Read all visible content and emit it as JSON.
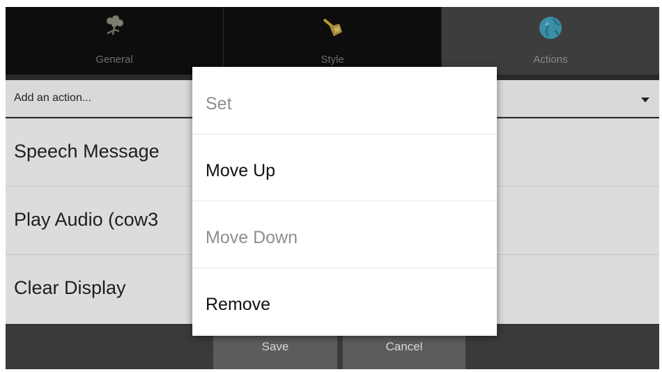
{
  "tabs": [
    {
      "label": "General",
      "icon": "flower-icon",
      "active": false
    },
    {
      "label": "Style",
      "icon": "paintbrush-icon",
      "active": false
    },
    {
      "label": "Actions",
      "icon": "globe-icon",
      "active": true
    }
  ],
  "spinner": {
    "label": "Add an action..."
  },
  "actions": [
    {
      "label": "Speech Message"
    },
    {
      "label": "Play Audio (cow3"
    },
    {
      "label": "Clear Display"
    }
  ],
  "buttons": {
    "save": "Save",
    "cancel": "Cancel"
  },
  "menu": {
    "items": [
      {
        "label": "Set",
        "enabled": false
      },
      {
        "label": "Move Up",
        "enabled": true
      },
      {
        "label": "Move Down",
        "enabled": false
      },
      {
        "label": "Remove",
        "enabled": true
      }
    ]
  },
  "colors": {
    "tab_bar": "#0d0d0d",
    "tab_active": "#3d3d3d",
    "list_bg": "#dcdcdc",
    "menu_bg": "#ffffff",
    "disabled_text": "#8e8e8e"
  }
}
